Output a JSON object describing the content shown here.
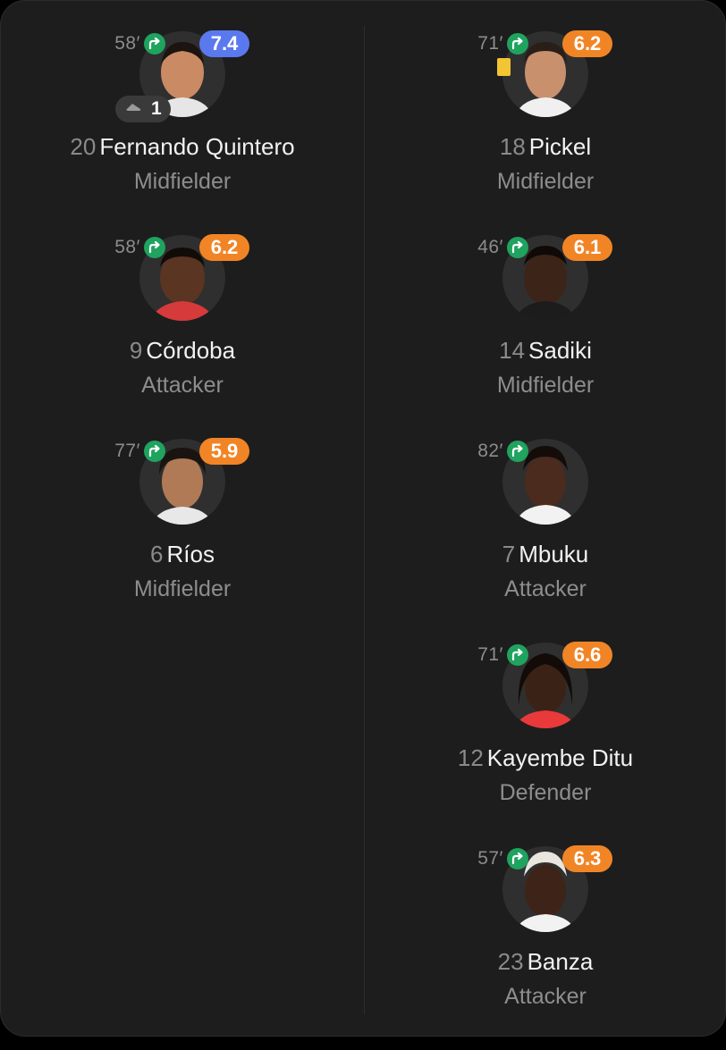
{
  "colors": {
    "background": "#1d1d1d",
    "rating_high": "#5b79ef",
    "rating_mid": "#f18526",
    "sub_in": "#1fa35f",
    "yellow_card": "#f3c433"
  },
  "left_players": [
    {
      "minute": "58′",
      "rating": "7.4",
      "rating_color": "blue",
      "goals": "1",
      "shirt": "20",
      "name": "Fernando Quintero",
      "position": "Midfielder"
    },
    {
      "minute": "58′",
      "rating": "6.2",
      "rating_color": "orange",
      "shirt": "9",
      "name": "Córdoba",
      "position": "Attacker"
    },
    {
      "minute": "77′",
      "rating": "5.9",
      "rating_color": "orange",
      "shirt": "6",
      "name": "Ríos",
      "position": "Midfielder"
    }
  ],
  "right_players": [
    {
      "minute": "71′",
      "rating": "6.2",
      "rating_color": "orange",
      "yellow_card": true,
      "shirt": "18",
      "name": "Pickel",
      "position": "Midfielder"
    },
    {
      "minute": "46′",
      "rating": "6.1",
      "rating_color": "orange",
      "shirt": "14",
      "name": "Sadiki",
      "position": "Midfielder"
    },
    {
      "minute": "82′",
      "shirt": "7",
      "name": "Mbuku",
      "position": "Attacker"
    },
    {
      "minute": "71′",
      "rating": "6.6",
      "rating_color": "orange",
      "shirt": "12",
      "name": "Kayembe Ditu",
      "position": "Defender"
    },
    {
      "minute": "57′",
      "rating": "6.3",
      "rating_color": "orange",
      "shirt": "23",
      "name": "Banza",
      "position": "Attacker"
    }
  ],
  "icons": {
    "substitution": "sub-in-arrow-icon",
    "goal": "football-boot-icon",
    "avatar": "player-photo"
  }
}
